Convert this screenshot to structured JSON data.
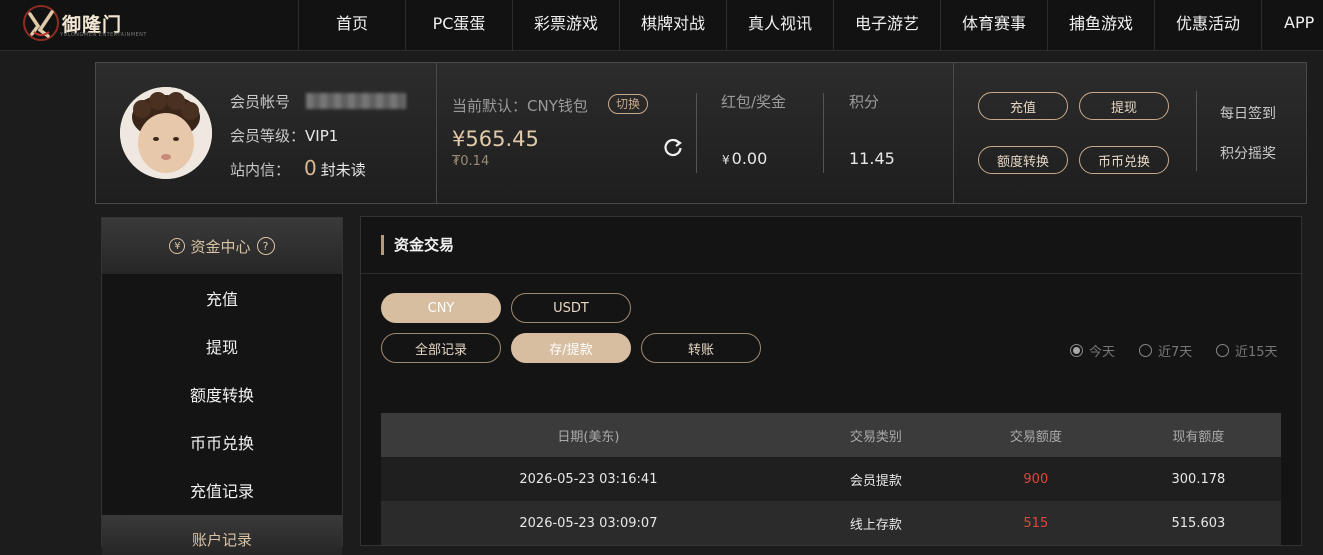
{
  "nav": {
    "brand": "御隆门",
    "brand_sub": "YULONGMEN ENTERTAINMENT",
    "items": [
      "首页",
      "PC蛋蛋",
      "彩票游戏",
      "棋牌对战",
      "真人视讯",
      "电子游艺",
      "体育赛事",
      "捕鱼游戏",
      "优惠活动",
      "APP"
    ]
  },
  "account": {
    "member_label": "会员帐号",
    "level_label": "会员等级：",
    "level_value": "VIP1",
    "message_label": "站内信：",
    "message_count": "0",
    "message_unread": "封未读",
    "wallet_label": "当前默认：CNY钱包",
    "switch_label": "切换",
    "balance": "¥565.45",
    "sub_balance": "₮0.14",
    "bonus_label": "红包/奖金",
    "bonus_currency": "¥",
    "bonus_value": "0.00",
    "points_label": "积分",
    "points_value": "11.45",
    "actions": [
      "充值",
      "提现",
      "额度转换",
      "币币兑换"
    ],
    "daily_signin": "每日签到",
    "points_lottery": "积分摇奖"
  },
  "sidebar": {
    "section_title": "资金中心",
    "section_icon": "¥",
    "help_icon": "?",
    "items": [
      "充值",
      "提现",
      "额度转换",
      "币币兑换",
      "充值记录"
    ],
    "section2_title": "账户记录"
  },
  "main": {
    "title": "资金交易",
    "currency_tabs": [
      "CNY",
      "USDT"
    ],
    "record_tabs": [
      "全部记录",
      "存/提款",
      "转账"
    ],
    "ranges": [
      "今天",
      "近7天",
      "近15天"
    ],
    "table": {
      "headers": [
        "日期(美东)",
        "交易类别",
        "交易额度",
        "现有额度"
      ],
      "rows": [
        [
          "2026-05-23 03:16:41",
          "会员提款",
          "900",
          "300.178"
        ],
        [
          "2026-05-23 03:09:07",
          "线上存款",
          "515",
          "515.603"
        ]
      ]
    }
  },
  "colors": {
    "accent": "#d8bea1",
    "gold_text": "#e0c9a8",
    "amount_red": "#e0463e",
    "background": "#1c1c1c"
  }
}
